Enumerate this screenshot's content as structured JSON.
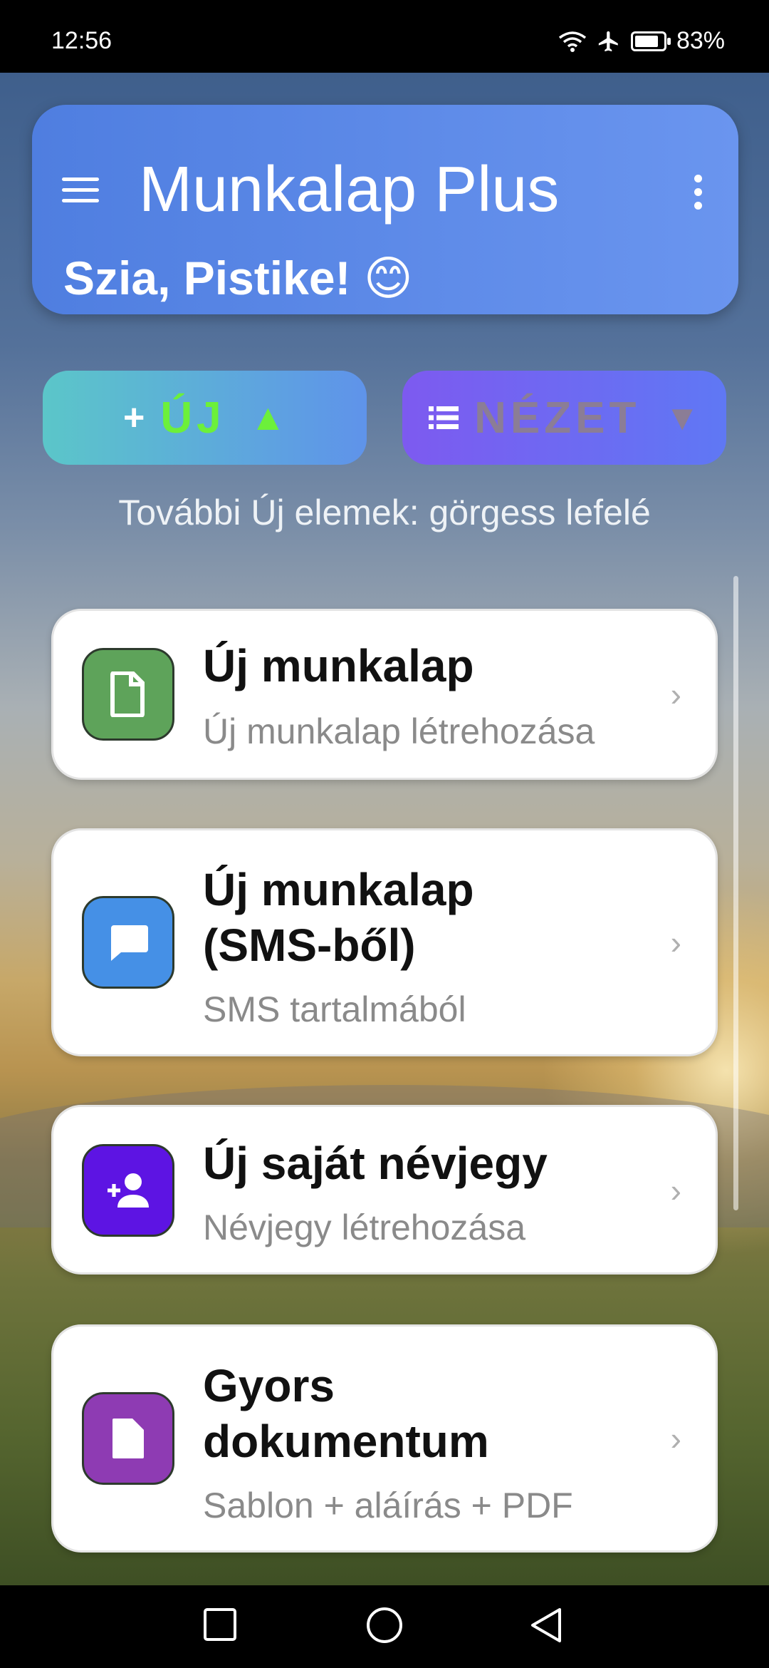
{
  "status_bar": {
    "time": "12:56",
    "battery": "83%",
    "battery_level": 0.83
  },
  "header": {
    "title": "Munkalap Plus",
    "greeting": "Szia, Pistike! 😊"
  },
  "actions": {
    "new": {
      "plus": "+",
      "label": "ÚJ",
      "arrow": "▲"
    },
    "view": {
      "label": "NÉZET",
      "arrow": "▼"
    },
    "hint": "További Új elemek: görgess lefelé"
  },
  "items": [
    {
      "title": "Új munkalap",
      "subtitle": "Új munkalap létrehozása",
      "icon": "document-icon",
      "color": "#5ea35a"
    },
    {
      "title": "Új munkalap (SMS-ből)",
      "subtitle": "SMS tartalmából",
      "icon": "message-icon",
      "color": "#4590e6"
    },
    {
      "title": "Új saját névjegy",
      "subtitle": "Névjegy létrehozása",
      "icon": "add-person-icon",
      "color": "#5d14e3"
    },
    {
      "title": "Gyors dokumentum",
      "subtitle": "Sablon + aláírás + PDF",
      "icon": "file-icon",
      "color": "#8e3bb3"
    }
  ],
  "nav": {
    "buttons": [
      "recents",
      "home",
      "back"
    ]
  }
}
